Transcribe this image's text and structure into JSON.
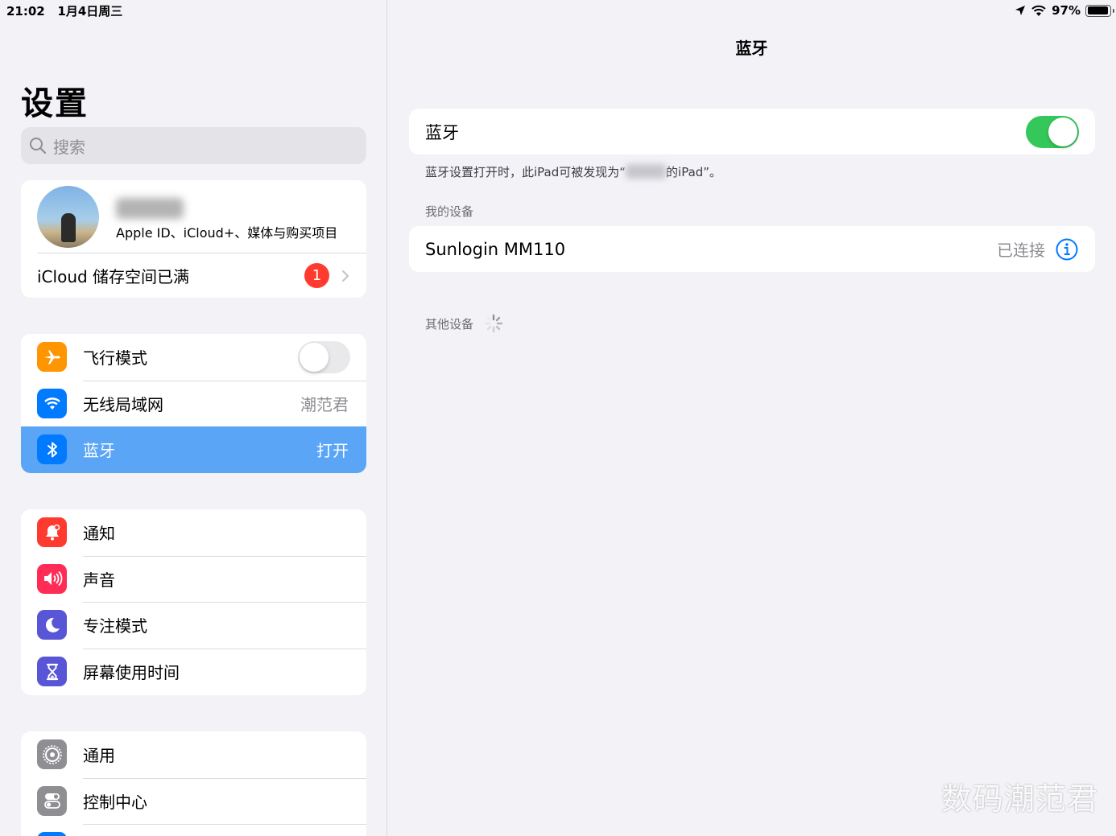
{
  "status_bar": {
    "time": "21:02",
    "date": "1月4日周三",
    "battery": "97%"
  },
  "sidebar": {
    "title": "设置",
    "search_placeholder": "搜索",
    "profile": {
      "subtitle": "Apple ID、iCloud+、媒体与购买项目",
      "icloud_label": "iCloud 储存空间已满",
      "badge": "1"
    },
    "group1": [
      {
        "label": "飞行模式",
        "icon": "airplane-icon",
        "color": "#ff9500",
        "toggle": "off"
      },
      {
        "label": "无线局域网",
        "value": "潮范君",
        "icon": "wifi-icon",
        "color": "#007aff"
      },
      {
        "label": "蓝牙",
        "value": "打开",
        "icon": "bluetooth-icon",
        "color": "#007aff",
        "selected": true
      }
    ],
    "group2": [
      {
        "label": "通知",
        "icon": "bell-icon",
        "color": "#ff3b30"
      },
      {
        "label": "声音",
        "icon": "speaker-icon",
        "color": "#ff2d55"
      },
      {
        "label": "专注模式",
        "icon": "moon-icon",
        "color": "#5856d6"
      },
      {
        "label": "屏幕使用时间",
        "icon": "hourglass-icon",
        "color": "#5856d6"
      }
    ],
    "group3": [
      {
        "label": "通用",
        "icon": "gear-icon",
        "color": "#8e8e93"
      },
      {
        "label": "控制中心",
        "icon": "toggles-icon",
        "color": "#8e8e93"
      }
    ]
  },
  "detail": {
    "title": "蓝牙",
    "bluetooth_label": "蓝牙",
    "bluetooth_state": "on",
    "footnote_prefix": "蓝牙设置打开时，此iPad可被发现为“",
    "footnote_suffix": "的iPad”。",
    "my_devices_header": "我的设备",
    "device_name": "Sunlogin MM110",
    "device_status": "已连接",
    "other_devices_header": "其他设备"
  },
  "watermark": "数码潮范君"
}
